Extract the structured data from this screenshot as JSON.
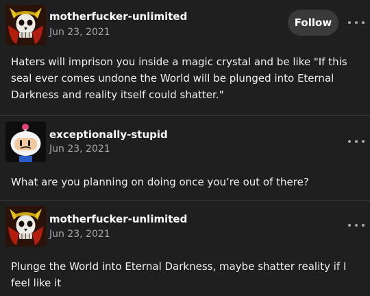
{
  "posts": [
    {
      "username": "motherfucker-unlimited",
      "date": "Jun 23, 2021",
      "follow_label": "Follow",
      "body": "Haters will imprison you inside a magic crystal and be like \"If this seal ever comes undone the World will be plunged into Eternal Darkness and reality itself could shatter.\"",
      "avatar_icon": "skull-warrior-avatar"
    },
    {
      "username": "exceptionally-stupid",
      "date": "Jun 23, 2021",
      "body": "What are you planning on doing once you’re out of there?",
      "avatar_icon": "bomberman-avatar"
    },
    {
      "username": "motherfucker-unlimited",
      "date": "Jun 23, 2021",
      "body": "Plunge the World into Eternal Darkness, maybe shatter reality if I feel like it",
      "avatar_icon": "skull-warrior-avatar"
    }
  ],
  "colors": {
    "background": "#1f1f1f",
    "divider": "#3a3a3a",
    "secondary_text": "#a6a6a6",
    "follow_button_bg": "#3a3a3a"
  }
}
